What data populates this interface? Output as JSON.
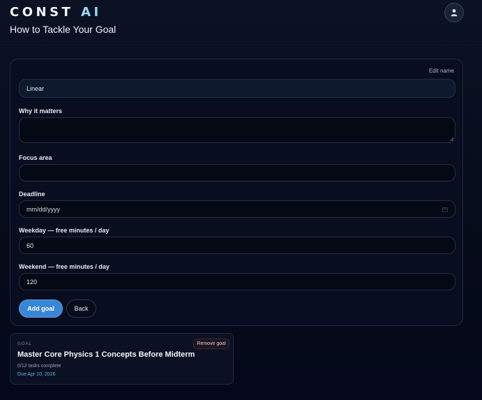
{
  "header": {
    "brand_const": "CONST",
    "brand_ai": "AI",
    "page_title": "How to Tackle Your Goal"
  },
  "form": {
    "edit_name_label": "Edit name",
    "name_value": "Linear",
    "why_label": "Why it matters",
    "why_value": "",
    "focus_label": "Focus area",
    "focus_value": "",
    "deadline_label": "Deadline",
    "deadline_placeholder": "mm/dd/yyyy",
    "weekday_label": "Weekday — free minutes / day",
    "weekday_value": "60",
    "weekend_label": "Weekend — free minutes / day",
    "weekend_value": "120",
    "add_goal_label": "Add goal",
    "back_label": "Back"
  },
  "goals": [
    {
      "kicker": "GOAL",
      "title": "Master Core Physics 1 Concepts Before Midterm",
      "progress": "0/12 tasks complete",
      "due": "Due Apr 10, 2026",
      "remove_label": "Remove goal"
    }
  ],
  "colors": {
    "accent": "#3a86d6",
    "brand_ai": "#9ed6f5",
    "due_text": "#6aaee0"
  },
  "icons": {
    "avatar": "user-icon",
    "deadline": "calendar-icon"
  }
}
